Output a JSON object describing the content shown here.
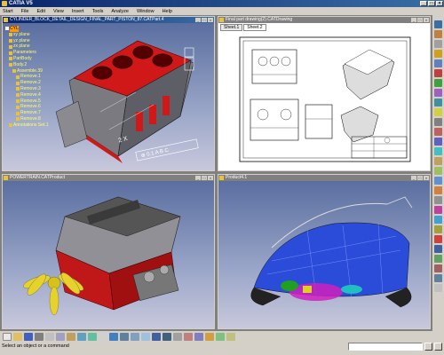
{
  "app": {
    "title": "CATIA V5"
  },
  "menu": [
    "Start",
    "File",
    "Edit",
    "View",
    "Insert",
    "Tools",
    "Analyze",
    "Window",
    "Help"
  ],
  "windows": {
    "part": {
      "title": "CYLINDER_BLOCK_DETAIL_DESIGN_FINAL_PART_PISTON_87.CATPart.4",
      "tree": [
        "CYL",
        "xy plane",
        "yz plane",
        "zx plane",
        "Parameters",
        "PartBody",
        "Body.2",
        "Assemble.39",
        "Remove.1",
        "Remove.2",
        "Remove.3",
        "Remove.4",
        "Remove.5",
        "Remove.6",
        "Remove.7",
        "Remove.8",
        "Annotations Set.1"
      ],
      "annotations": [
        "1",
        "X",
        "0.02",
        "A B C"
      ]
    },
    "drawing": {
      "title": "Final part drawing(2).CATDrawing",
      "tabs": [
        "Sheet.1",
        "Sheet.2"
      ]
    },
    "powertrain": {
      "title": "POWERTRAIN.CATProduct"
    },
    "product": {
      "title": "Product4.1"
    }
  },
  "status": {
    "prompt": "Select an object or a command"
  },
  "colors": {
    "titlebar": "#0a246a",
    "part_red": "#d01818",
    "tree_text": "#ffff66",
    "view_bg": "#5a6ea0"
  }
}
